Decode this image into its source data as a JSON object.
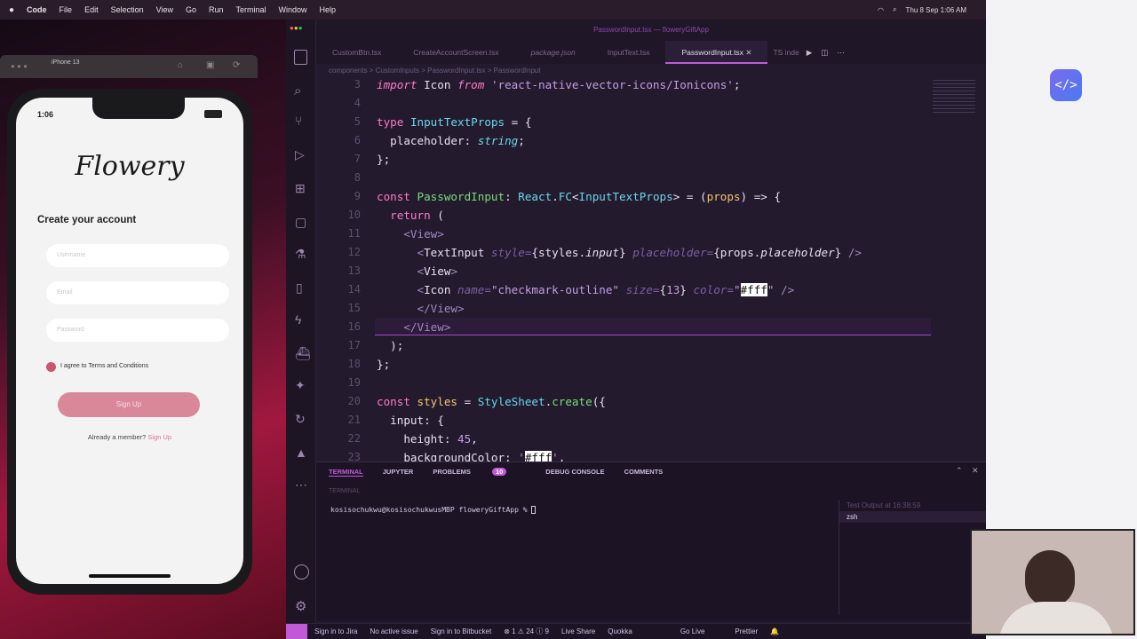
{
  "menubar": {
    "app": "Code",
    "items": [
      "File",
      "Edit",
      "Selection",
      "View",
      "Go",
      "Run",
      "Terminal",
      "Window",
      "Help"
    ],
    "clock": "Thu 8 Sep  1:06 AM"
  },
  "simulator": {
    "device": "iPhone 13",
    "time": "1:06",
    "app_title": "Flowery",
    "heading": "Create your account",
    "username_placeholder": "Username",
    "email_placeholder": "Email",
    "password_placeholder": "Password",
    "terms_label": "I agree to Terms and Conditions",
    "signup_button": "Sign Up",
    "member_text": "Already a member?",
    "signin_link": "Sign Up"
  },
  "editor": {
    "window_title": "PasswordInput.tsx — floweryGiftApp",
    "tabs": [
      "CustomBtn.tsx",
      "CreateAccountScreen.tsx",
      "package.json",
      "InputText.tsx",
      "PasswordInput.tsx",
      "TS inde"
    ],
    "active_tab_index": 4,
    "breadcrumb": "components > CustomInputs > PasswordInput.tsx > PasswordInput",
    "line_numbers": [
      "3",
      "4",
      "5",
      "6",
      "7",
      "8",
      "9",
      "10",
      "11",
      "12",
      "13",
      "14",
      "15",
      "16",
      "17",
      "18",
      "19",
      "20",
      "21",
      "22",
      "23"
    ],
    "current_line": "16"
  },
  "panel": {
    "tabs": [
      "TERMINAL",
      "JUPYTER",
      "PROBLEMS",
      "DEBUG CONSOLE",
      "COMMENTS"
    ],
    "problems_count": "10",
    "terminal_label": "TERMINAL",
    "prompt": "kosisochukwu@kosisochukwusMBP floweryGiftApp % ",
    "side_items": [
      "Test Output at 16:38:59",
      "zsh"
    ]
  },
  "statusbar": {
    "items": [
      "Sign in to Jira",
      "No active issue",
      "Sign in to Bitbucket",
      "⊗ 1 ⚠ 24 ⓘ 9",
      "Live Share",
      "Quokka",
      "Go Live",
      "Prettier"
    ]
  },
  "colors": {
    "accent": "#c25ad8",
    "signup_button": "#d9889a",
    "brand_pink": "#c8576f"
  }
}
